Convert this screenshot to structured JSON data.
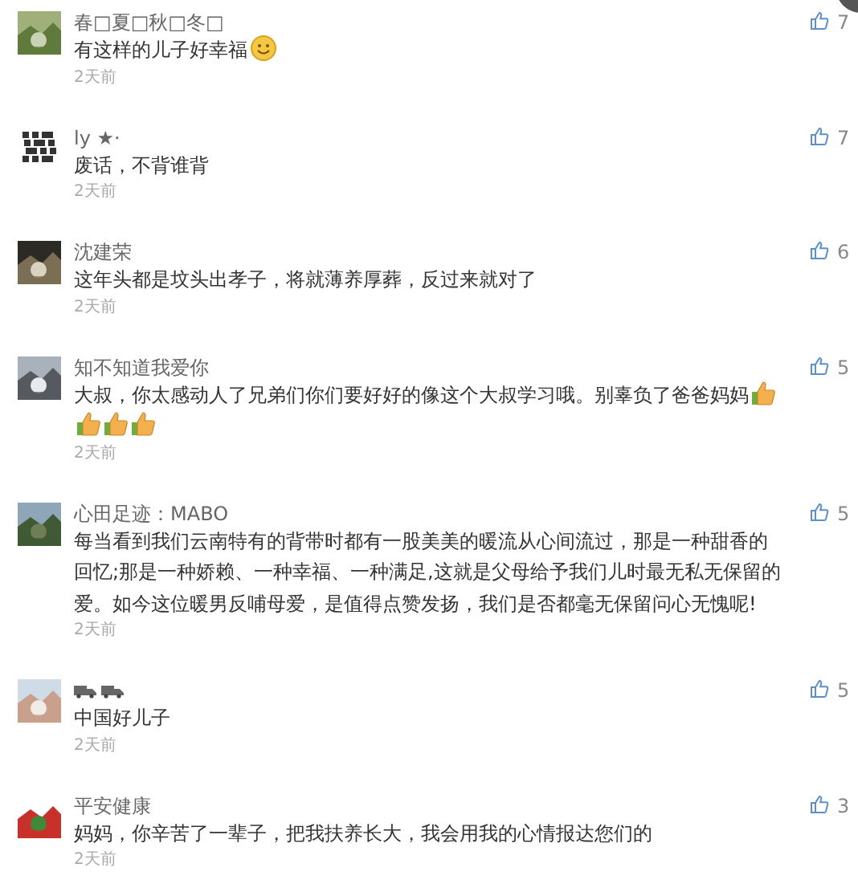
{
  "comments": [
    {
      "name": "春□夏□秋□冬□",
      "text": "有这样的儿子好幸福",
      "emoji": [
        {
          "kind": "smile"
        }
      ],
      "time": "2天前",
      "likes": "7"
    },
    {
      "name": "ly ★·",
      "text": "废话，不背谁背",
      "time": "2天前",
      "likes": "7"
    },
    {
      "name": "沈建荣",
      "text": "这年头都是坟头出孝子，将就薄养厚葬，反过来就对了",
      "time": "2天前",
      "likes": "6"
    },
    {
      "name": "知不知道我爱你",
      "text": "大叔，你太感动人了兄弟们你们要好好的像这个大叔学习哦。别辜负了爸爸妈妈",
      "emoji": [
        {
          "kind": "thumbs-up"
        },
        {
          "kind": "thumbs-up"
        },
        {
          "kind": "thumbs-up"
        },
        {
          "kind": "thumbs-up"
        }
      ],
      "time": "2天前",
      "likes": "5"
    },
    {
      "name": "心田足迹：MABO",
      "text": "每当看到我们云南特有的背带时都有一股美美的暖流从心间流过，那是一种甜香的回忆;那是一种娇赖、一种幸福、一种满足,这就是父母给予我们儿时最无私无保留的爱。如今这位暖男反哺母爱，是值得点赞发扬，我们是否都毫无保留问心无愧呢!",
      "time": "2天前",
      "likes": "5"
    },
    {
      "name_icons": [
        {
          "kind": "truck"
        },
        {
          "kind": "truck"
        }
      ],
      "text": "中国好儿子",
      "time": "2天前",
      "likes": "5"
    },
    {
      "name": "平安健康",
      "text": "妈妈，你辛苦了一辈子，把我扶养长大，我会用我的心情报达您们的",
      "time": "2天前",
      "likes": "3"
    }
  ]
}
